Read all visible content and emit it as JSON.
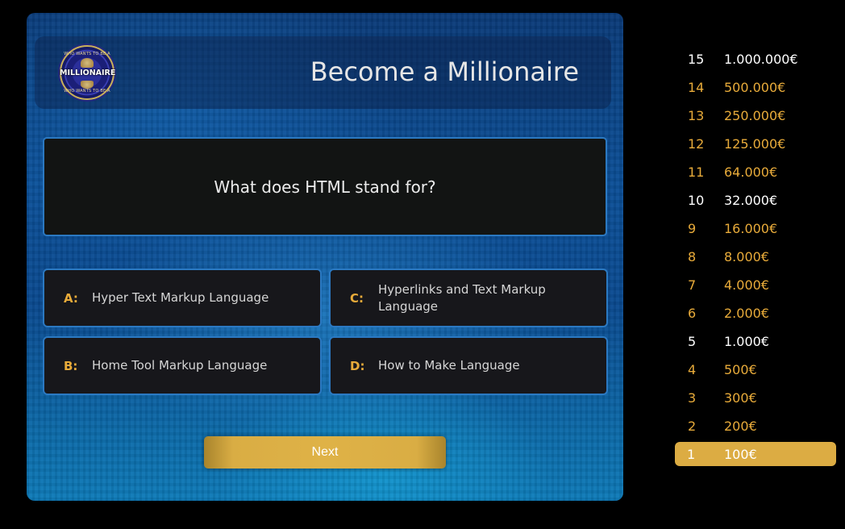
{
  "header": {
    "title": "Become a Millionaire",
    "logo": {
      "word": "MILLIONAIRE",
      "ring_top": "WHO WANTS TO BE A",
      "ring_bottom": "WHO WANTS TO BE A"
    }
  },
  "question": {
    "text": "What does HTML stand for?"
  },
  "answers": [
    {
      "letter": "A:",
      "text": "Hyper Text Markup Language"
    },
    {
      "letter": "B:",
      "text": "Home Tool Markup Language"
    },
    {
      "letter": "C:",
      "text": "Hyperlinks and Text Markup Language"
    },
    {
      "letter": "D:",
      "text": "How to Make Language"
    }
  ],
  "next_label": "Next",
  "prize_ladder": [
    {
      "level": "15",
      "amount": "1.000.000€",
      "milestone": true
    },
    {
      "level": "14",
      "amount": "500.000€",
      "milestone": false
    },
    {
      "level": "13",
      "amount": "250.000€",
      "milestone": false
    },
    {
      "level": "12",
      "amount": "125.000€",
      "milestone": false
    },
    {
      "level": "11",
      "amount": "64.000€",
      "milestone": false
    },
    {
      "level": "10",
      "amount": "32.000€",
      "milestone": true
    },
    {
      "level": "9",
      "amount": "16.000€",
      "milestone": false
    },
    {
      "level": "8",
      "amount": "8.000€",
      "milestone": false
    },
    {
      "level": "7",
      "amount": "4.000€",
      "milestone": false
    },
    {
      "level": "6",
      "amount": "2.000€",
      "milestone": false
    },
    {
      "level": "5",
      "amount": "1.000€",
      "milestone": true
    },
    {
      "level": "4",
      "amount": "500€",
      "milestone": false
    },
    {
      "level": "3",
      "amount": "300€",
      "milestone": false
    },
    {
      "level": "2",
      "amount": "200€",
      "milestone": false
    },
    {
      "level": "1",
      "amount": "100€",
      "milestone": false,
      "current": true
    }
  ],
  "colors": {
    "accent_gold": "#dcac43",
    "answer_letter": "#e8ab3a",
    "border_blue": "#2b79c2"
  }
}
